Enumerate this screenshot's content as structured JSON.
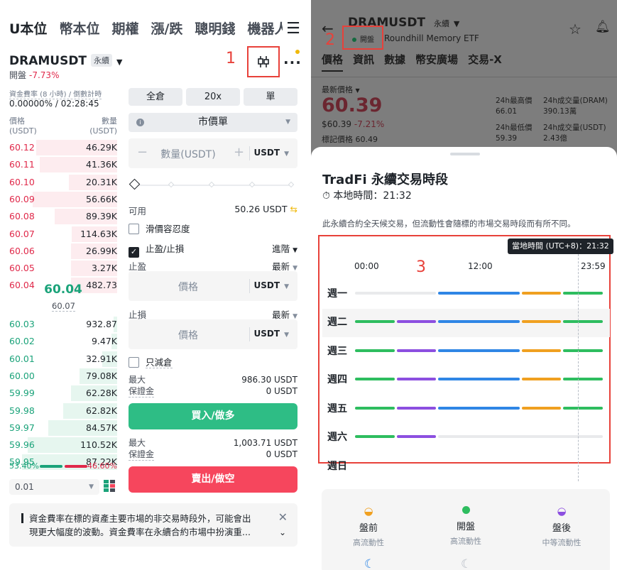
{
  "left": {
    "tabs": [
      "U本位",
      "幣本位",
      "期權",
      "漲/跌",
      "聰明錢",
      "機器人"
    ],
    "symbol": "DRAMUSDT",
    "perp_badge": "永續",
    "status": "開盤",
    "change": "-7.73%",
    "annotation_1": "1",
    "funding_label": "資金費率 (8 小時) / 倒數計時",
    "funding_value": "0.00000% / 02:28:45",
    "ob_price_label": "價格",
    "ob_price_unit": "(USDT)",
    "ob_qty_label": "數量",
    "ob_qty_unit": "(USDT)",
    "asks": [
      {
        "p": "60.12",
        "q": "46.29K",
        "d": 0.75
      },
      {
        "p": "60.11",
        "q": "41.36K",
        "d": 0.72
      },
      {
        "p": "60.10",
        "q": "20.31K",
        "d": 0.45
      },
      {
        "p": "60.09",
        "q": "56.66K",
        "d": 0.78
      },
      {
        "p": "60.08",
        "q": "89.39K",
        "d": 0.58
      },
      {
        "p": "60.07",
        "q": "114.63K",
        "d": 0.42
      },
      {
        "p": "60.06",
        "q": "26.99K",
        "d": 0.43
      },
      {
        "p": "60.05",
        "q": "3.27K",
        "d": 0.43
      },
      {
        "p": "60.04",
        "q": "482.73",
        "d": 0.43
      }
    ],
    "mid_price": "60.04",
    "mark_price": "60.07",
    "bids": [
      {
        "p": "60.03",
        "q": "932.87",
        "d": 0.03
      },
      {
        "p": "60.02",
        "q": "9.47K",
        "d": 0.05
      },
      {
        "p": "60.01",
        "q": "32.91K",
        "d": 0.14
      },
      {
        "p": "60.00",
        "q": "79.08K",
        "d": 0.35
      },
      {
        "p": "59.99",
        "q": "62.28K",
        "d": 0.43
      },
      {
        "p": "59.98",
        "q": "62.82K",
        "d": 0.5
      },
      {
        "p": "59.97",
        "q": "84.57K",
        "d": 0.64
      },
      {
        "p": "59.96",
        "q": "110.52K",
        "d": 0.83
      },
      {
        "p": "59.95",
        "q": "87.22K",
        "d": 0.88
      }
    ],
    "ratio_buy": "53.40%",
    "ratio_sell": "46.60%",
    "precision": "0.01",
    "margin_mode": "全倉",
    "leverage": "20x",
    "position_mode": "單",
    "order_type": "市價單",
    "qty_placeholder": "數量(USDT)",
    "qty_unit": "USDT",
    "available_label": "可用",
    "available_value": "50.26 USDT",
    "slippage_label": "滑價容忍度",
    "tpsl_label": "止盈/止損",
    "advanced_label": "進階",
    "tp_label": "止盈",
    "tp_trigger": "最新",
    "price_placeholder": "價格",
    "price_unit": "USDT",
    "sl_label": "止損",
    "sl_trigger": "最新",
    "reduce_only_label": "只減倉",
    "max_label": "最大",
    "margin_label": "保證金",
    "buy_max": "986.30 USDT",
    "buy_margin": "0 USDT",
    "buy_button": "買入/做多",
    "sell_max": "1,003.71 USDT",
    "sell_margin": "0 USDT",
    "sell_button": "賣出/做空",
    "notice_line1": "資金費率在標的資產主要市場的非交易時段外，可能會出",
    "notice_line2": "現更大幅度的波動。資金費率在永續合約市場中扮演重..."
  },
  "right": {
    "symbol": "DRAMUSDT",
    "perp_badge": "永續",
    "status": "開盤",
    "underlying": "Roundhill Memory ETF",
    "annotation_2": "2",
    "annotation_3": "3",
    "tabs": [
      "價格",
      "資訊",
      "數據",
      "幣安廣場",
      "交易-X"
    ],
    "last_price_label": "最新價格",
    "last_price": "60.39",
    "usd_price": "$60.39",
    "change": "-7.21%",
    "mark_label": "標記價格",
    "mark_value": "60.49",
    "high_label": "24h最高價",
    "high_value": "66.01",
    "low_label": "24h最低價",
    "low_value": "59.39",
    "vol_dram_label": "24h成交量(DRAM)",
    "vol_dram_value": "390.13萬",
    "vol_usdt_label": "24h成交量(USDT)",
    "vol_usdt_value": "2.43億",
    "sheet_title": "TradFi 永續交易時段",
    "local_time": "本地時間：21:32",
    "description": "此永續合約全天候交易，但流動性會隨標的市場交易時段而有所不同。",
    "tooltip": "當地時間 (UTC+8)：21:32",
    "hours": [
      "00:00",
      "12:00",
      "23:59"
    ],
    "days": [
      "週一",
      "週二",
      "週三",
      "週四",
      "週五",
      "週六",
      "週日"
    ],
    "legend": [
      {
        "name": "盤前",
        "sub": "高流動性"
      },
      {
        "name": "開盤",
        "sub": "高流動性"
      },
      {
        "name": "盤後",
        "sub": "中等流動性"
      }
    ],
    "colors": {
      "overnight": "#2ebd5f",
      "premarket": "#8c4fe0",
      "regular": "#2f86e5",
      "postmarket": "#f0a020",
      "closed": "#e9eaec"
    }
  }
}
